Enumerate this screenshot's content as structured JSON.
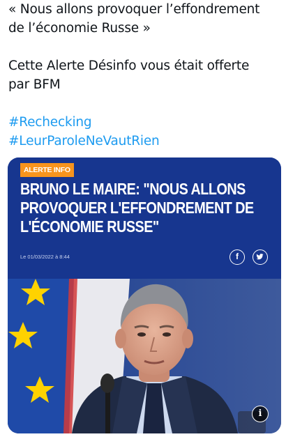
{
  "tweet": {
    "line1": "« Nous allons provoquer l’effondrement",
    "line2": "de l’économie Russe »",
    "line3": "Cette Alerte Désinfo vous était offerte",
    "line4": "par BFM",
    "hashtags": [
      "#Rechecking",
      "#LeurParoleNeVautRien"
    ]
  },
  "card": {
    "badge": "ALERTE INFO",
    "headline_lines": [
      "BRUNO LE MAIRE: \"NOUS ALLONS",
      "PROVOQUER L'EFFONDREMENT DE",
      "L'ÉCONOMIE RUSSE\""
    ],
    "date": "Le 01/03/2022 à 8:44",
    "share_icons": [
      "facebook-icon",
      "twitter-icon"
    ],
    "info_icon": "info-icon",
    "colors": {
      "header_bg": "#17368f",
      "badge_bg": "#f7941d",
      "hashtag": "#1d9bf0",
      "eu_flag_blue": "#1f4aa8",
      "eu_star": "#ffd200"
    }
  }
}
